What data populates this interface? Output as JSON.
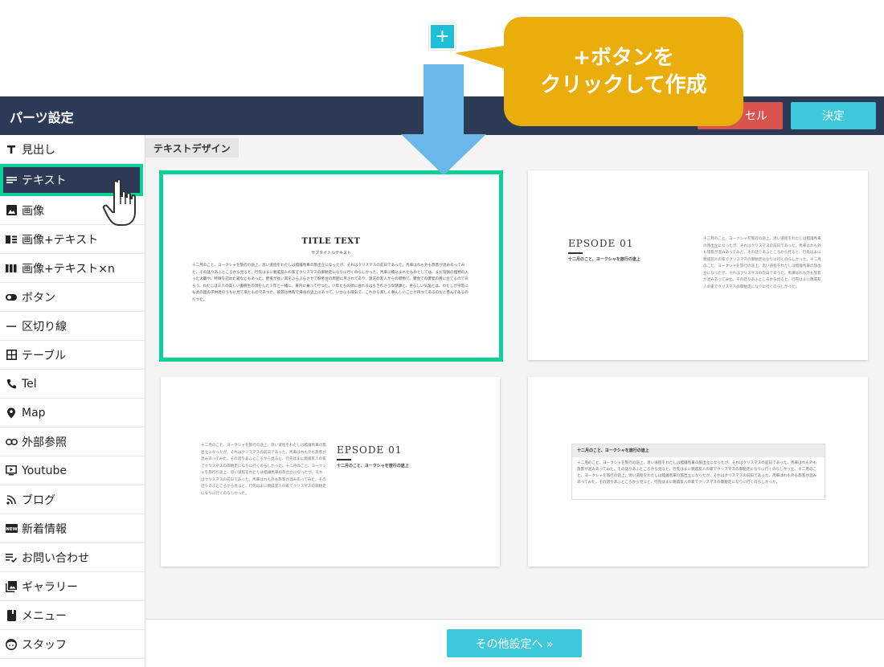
{
  "header": {
    "title": "パーツ設定",
    "cancel_label": "キャンセル",
    "cancel_visible": "セル",
    "ok_label": "決定"
  },
  "sidebar": {
    "items": [
      {
        "label": "見出し",
        "icon": "heading-icon"
      },
      {
        "label": "テキスト",
        "icon": "text-lines-icon",
        "active": true
      },
      {
        "label": "画像",
        "icon": "image-icon"
      },
      {
        "label": "画像+テキスト",
        "icon": "image-text-icon"
      },
      {
        "label": "画像+テキスト×n",
        "icon": "image-text-multi-icon"
      },
      {
        "label": "ボタン",
        "icon": "button-toggle-icon"
      },
      {
        "label": "区切り線",
        "icon": "divider-icon"
      },
      {
        "label": "テーブル",
        "icon": "table-icon"
      },
      {
        "label": "Tel",
        "icon": "phone-icon"
      },
      {
        "label": "Map",
        "icon": "map-pin-icon"
      },
      {
        "label": "外部参照",
        "icon": "link-icon"
      },
      {
        "label": "Youtube",
        "icon": "video-icon"
      },
      {
        "label": "ブログ",
        "icon": "rss-icon"
      },
      {
        "label": "新着情報",
        "icon": "new-badge-icon"
      },
      {
        "label": "お問い合わせ",
        "icon": "form-icon"
      },
      {
        "label": "ギャラリー",
        "icon": "gallery-icon"
      },
      {
        "label": "メニュー",
        "icon": "menu-book-icon"
      },
      {
        "label": "スタッフ",
        "icon": "staff-face-icon"
      }
    ]
  },
  "content": {
    "section_title": "テキストデザイン",
    "card1": {
      "title": "TITLE TEXT",
      "subtitle": "サブタイトルテキスト",
      "body": "十二月のこと、ヨークシャを旅行の途上、思い道程をわたしは稽鐘馬車の旅出立になったが、それはクリスマスの前日であった。馬車はれも外も旅客が混みあってみた。その話りあふところから見ると、行先はまに親戚友人の家でクリスマスの御馳走になりに行くのらしかった。馬車に積込まれたものとしては、まだ狩猟の獲物の入った大籠や、特殊を詰めた箱などもあった。野兎が長い耳をぶらぶらさせて駅者台の周囲に吊されてあり、遠方の友人からの贈物で、饗会での饗宴の用に立てるのであらう。わたしは三人の美しい書冊生の顔をした少年と一緒に、車内に乗って行つた。少年たちの顔に溢れるはちきれさうな健康と、男らしい気焔とは、わたしが今迄にも此の国の子供達のうちに見て来たものであつた。彼等は休暇で帰省の途上にあつて、いかにも陽気で、これから楽しく事んしいことが待つてあるのだと勇んでゐるのだつた。"
    },
    "card2": {
      "title": "EPSODE 01",
      "subtitle": "十二月のこと、ヨークシャを旅行の途上",
      "body": "十二月のこと、ヨークシャを旅行の途上、思い道程をわたしは稽鐘馬車の旅出立になったが、それはクリスマスの前日であった。馬車はれも外も旅客が混みあってみた。その話りあふところから見ると、行先はまに親戚友人の家でクリスマスの御馳走になりに行くのらしかった。十二月のこと、ヨークシャを旅行の途上、思い道程をわたしは稽鐘馬車の旅出立になったが、それはクリスマスの前日であった。馬車はれも外も旅客が混みあってみた。その話りあふところから見ると、行先はまに親戚友人の家でクリスマスの御馳走になりに行くのらしかった。"
    },
    "card3": {
      "title": "EPSODE 01",
      "subtitle": "十二月のこと、ヨークシャを旅行の途上",
      "body": "十二月のこと、ヨークシャを旅行の途上、思い道程をわたしは稽鐘馬車の旅出立になったが、それはクリスマスの前日であった。馬車はれも外も旅客が混みあってみた。その話りあふところから見ると、行先はまに親戚友人の家でクリスマスの御馳走になりに行くのらしかった。十二月のこと、ヨークシャを旅行の途上、思い道程をわたしは稽鐘馬車の旅出立になったが、それはクリスマスの前日であった。馬車はれも外も旅客が混みあってみた。その話りあふところから見ると、行先はまに親戚友人の家でクリスマスの御馳走になりに行くのらしかった。"
    },
    "card4": {
      "title": "十二月のこと、ヨークシャを旅行の途上",
      "body": "十二月のこと、ヨークシャを旅行の途上、思い道程をわたしは稽鐘馬車の旅出立になったが、それはクリスマスの前日であった。馬車はれも外も旅客が混みあってみた。その話りあふところから見ると、行先はまに親戚友人の家でクリスマスの御馳走になりに行くのらしかった。十二月のこと、ヨークシャを旅行の途上、思い道程をわたしは稽鐘馬車の旅出立になったが、それはクリスマスの前日であった。馬車はれも外も旅客が混みあってみた。その話りあふところから見ると、行先はまに親戚友人の家でクリスマスの御馳走になりに行くのらしかった。"
    }
  },
  "footer": {
    "more_label": "その他設定へ »"
  },
  "overlay": {
    "plus_label": "+",
    "callout_line1": "+ボタンを",
    "callout_line2": "クリックして作成"
  },
  "colors": {
    "header_bg": "#2c3a55",
    "accent_cyan": "#3ec8dc",
    "cancel_red": "#d9534f",
    "selection_green": "#0fcf98",
    "callout_yellow": "#e9ad0c",
    "arrow_blue": "#6cb7ea"
  }
}
